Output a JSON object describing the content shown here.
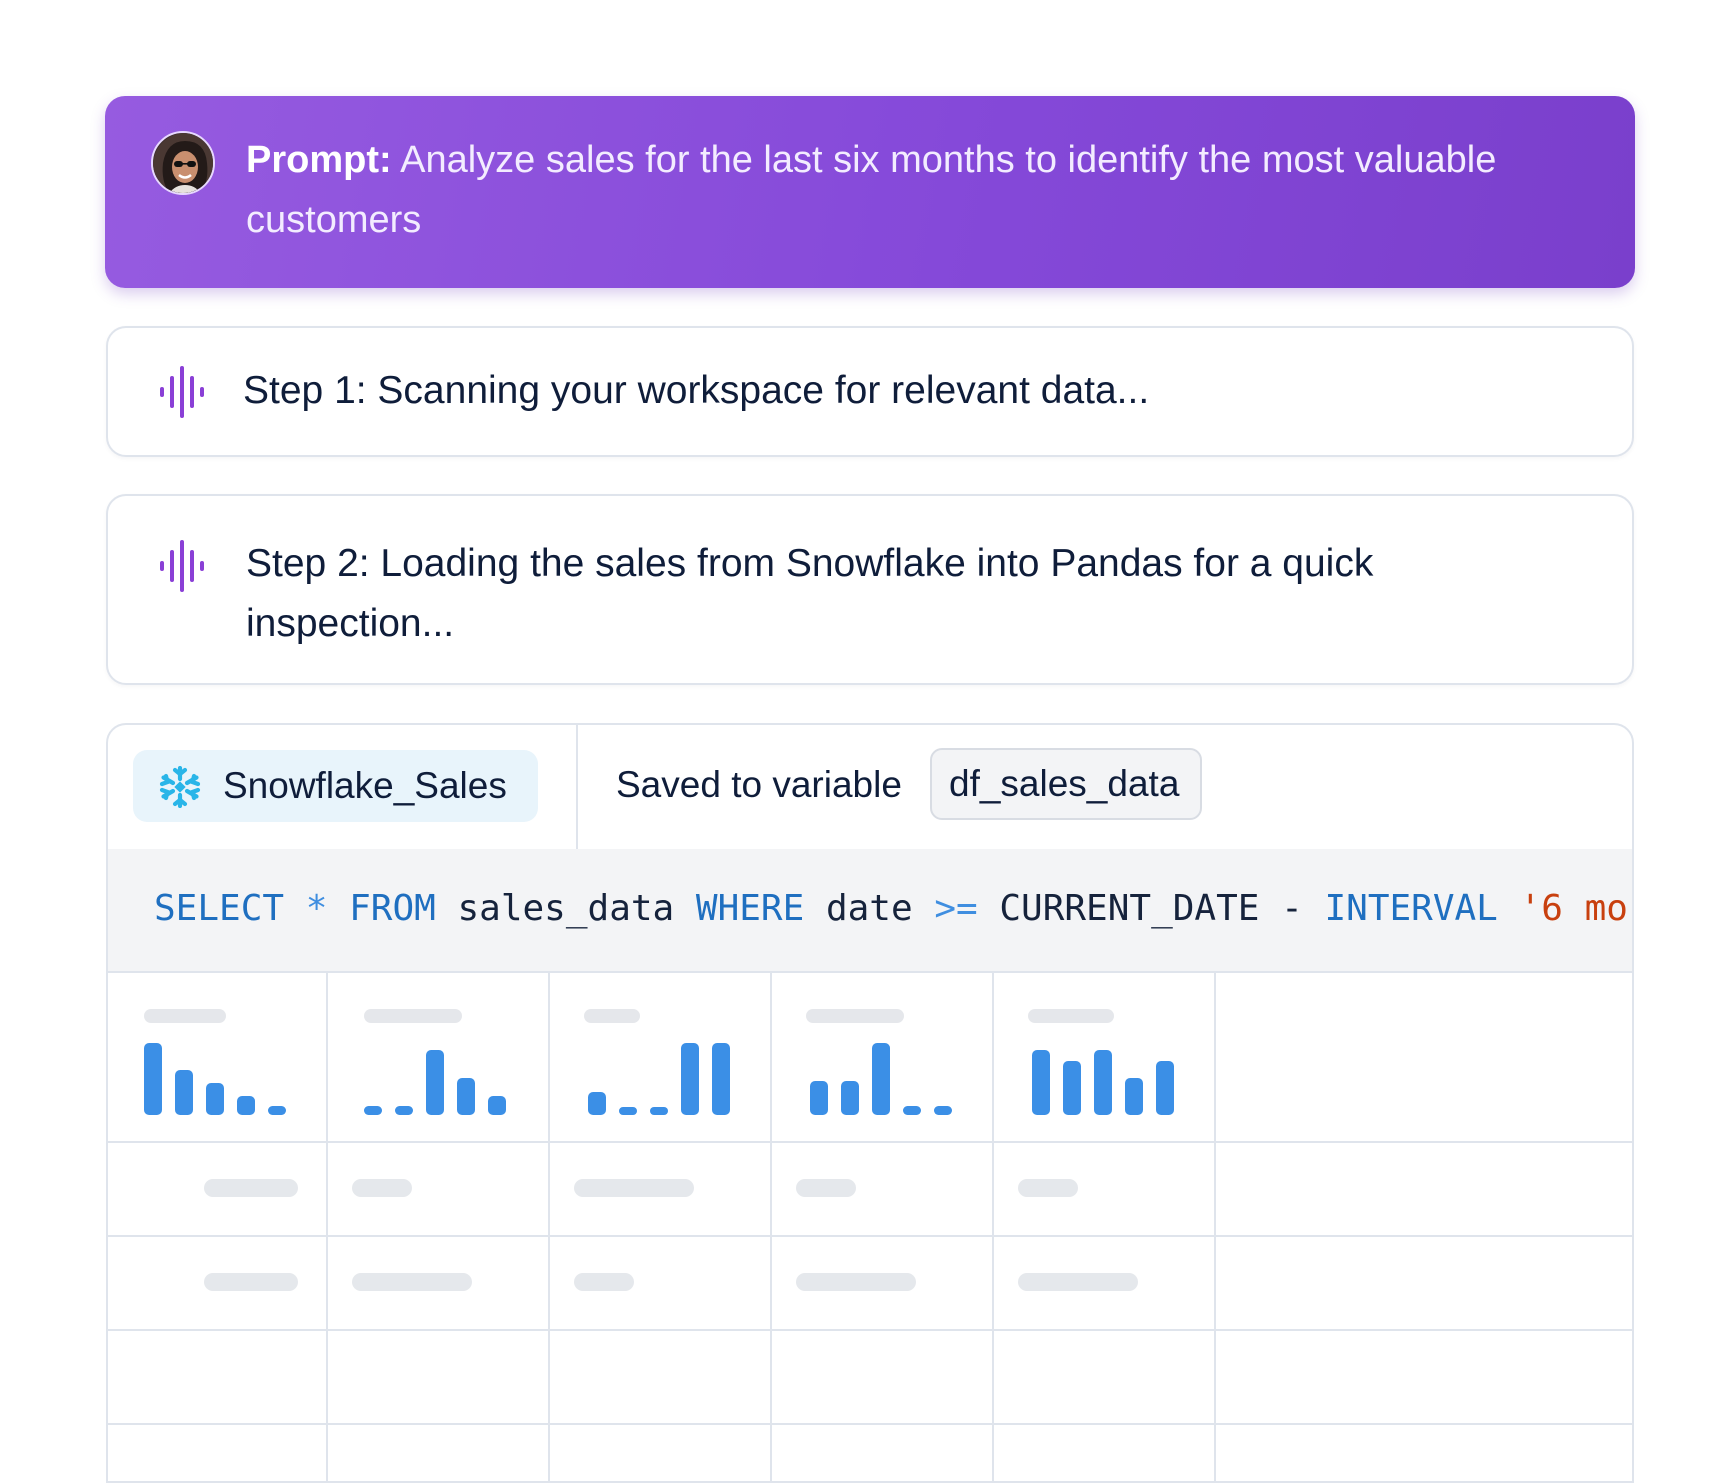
{
  "prompt": {
    "label": "Prompt:",
    "text": " Analyze sales for the last six months to identify the most valuable customers",
    "accent_color": "#8549d9"
  },
  "steps": [
    {
      "icon": "audio-wave-icon",
      "text": "Step 1: Scanning your workspace for relevant data..."
    },
    {
      "icon": "audio-wave-icon",
      "text": "Step 2: Loading the sales from Snowflake into Pandas for a quick inspection..."
    }
  ],
  "data_panel": {
    "source": {
      "icon": "snowflake-icon",
      "label": "Snowflake_Sales"
    },
    "saved_label": "Saved to variable",
    "variable": "df_sales_data",
    "sql": {
      "tokens": [
        {
          "t": "SELECT",
          "c": "kw"
        },
        {
          "t": " ",
          "c": "id"
        },
        {
          "t": "*",
          "c": "op"
        },
        {
          "t": " ",
          "c": "id"
        },
        {
          "t": "FROM",
          "c": "kw"
        },
        {
          "t": " sales_data ",
          "c": "id"
        },
        {
          "t": "WHERE",
          "c": "kw"
        },
        {
          "t": " date ",
          "c": "id"
        },
        {
          "t": ">=",
          "c": "op"
        },
        {
          "t": " CURRENT_DATE - ",
          "c": "id"
        },
        {
          "t": "INTERVAL",
          "c": "kw"
        },
        {
          "t": " ",
          "c": "id"
        },
        {
          "t": "'6 mo",
          "c": "str"
        }
      ]
    },
    "column_histograms": [
      [
        1.0,
        0.63,
        0.45,
        0.27,
        0.12
      ],
      [
        0.12,
        0.12,
        0.9,
        0.52,
        0.27
      ],
      [
        0.32,
        0.1,
        0.1,
        1.0,
        1.0
      ],
      [
        0.47,
        0.47,
        1.0,
        0.12,
        0.12
      ],
      [
        0.9,
        0.75,
        0.9,
        0.52,
        0.75
      ]
    ],
    "bar_color": "#3b8fe6"
  }
}
